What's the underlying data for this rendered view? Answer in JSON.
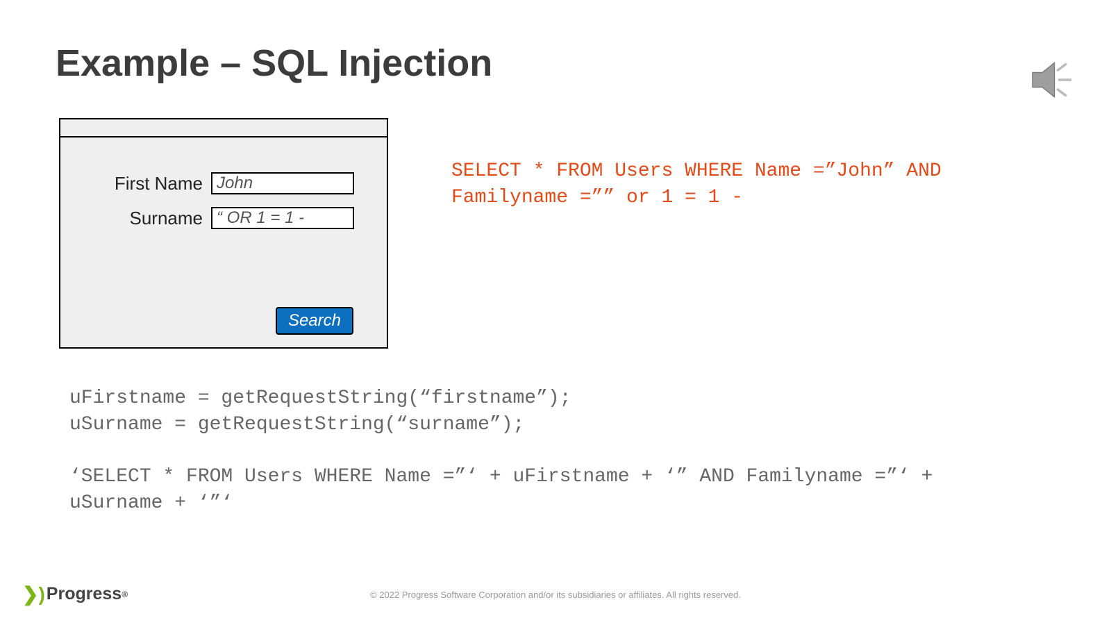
{
  "title": "Example – SQL Injection",
  "form": {
    "first_name_label": "First Name",
    "first_name_value": "John",
    "surname_label": "Surname",
    "surname_value": "“ OR 1 = 1 -",
    "search_label": "Search"
  },
  "sql_result": "SELECT * FROM Users WHERE Name =”John” AND\nFamilyname =”” or 1 = 1 -",
  "code": "uFirstname = getRequestString(“firstname”);\nuSurname = getRequestString(“surname”);\n\n‘SELECT * FROM Users WHERE Name =”‘ + uFirstname + ‘” AND Familyname =”‘ +\nuSurname + ‘”‘",
  "footer": {
    "brand": "Progress",
    "copyright": "© 2022 Progress Software Corporation and/or its subsidiaries or affiliates. All rights reserved."
  },
  "icons": {
    "speaker": "speaker-icon"
  }
}
